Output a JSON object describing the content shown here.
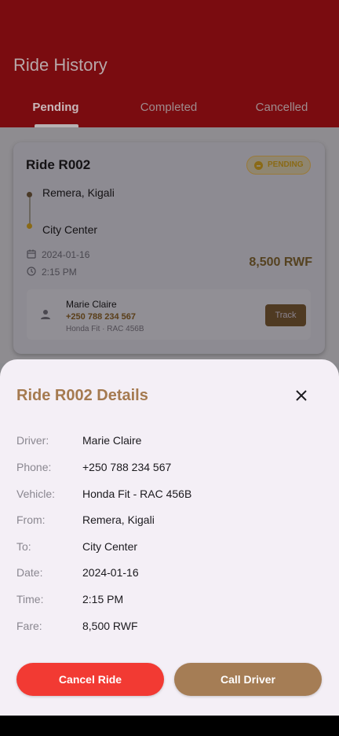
{
  "appbar": {
    "title": "Ride History",
    "color": "#7a0c10"
  },
  "tabs": [
    {
      "label": "Pending",
      "active": true
    },
    {
      "label": "Completed",
      "active": false
    },
    {
      "label": "Cancelled",
      "active": false
    }
  ],
  "card": {
    "title": "Ride R002",
    "status": "PENDING",
    "from": "Remera, Kigali",
    "to": "City Center",
    "date": "2024-01-16",
    "time": "2:15 PM",
    "fare": "8,500 RWF",
    "driver": {
      "name": "Marie Claire",
      "phone": "+250 788 234 567",
      "vehicle": "Honda Fit · RAC 456B"
    },
    "track_label": "Track",
    "icons": [
      "calendar-icon",
      "clock-icon",
      "person-icon",
      "status-dot-icon"
    ]
  },
  "sheet": {
    "title": "Ride R002 Details",
    "close_icon": "close-icon",
    "rows": [
      {
        "label": "Driver:",
        "value": "Marie Claire"
      },
      {
        "label": "Phone:",
        "value": "+250 788 234 567"
      },
      {
        "label": "Vehicle:",
        "value": "Honda Fit - RAC 456B"
      },
      {
        "label": "From:",
        "value": "Remera, Kigali"
      },
      {
        "label": "To:",
        "value": "City Center"
      },
      {
        "label": "Date:",
        "value": "2024-01-16"
      },
      {
        "label": "Time:",
        "value": "2:15 PM"
      },
      {
        "label": "Fare:",
        "value": "8,500 RWF"
      }
    ],
    "cancel_label": "Cancel Ride",
    "call_label": "Call Driver",
    "colors": {
      "accent": "#a57a50",
      "cancel": "#f23a33",
      "call": "#a57d55"
    }
  }
}
